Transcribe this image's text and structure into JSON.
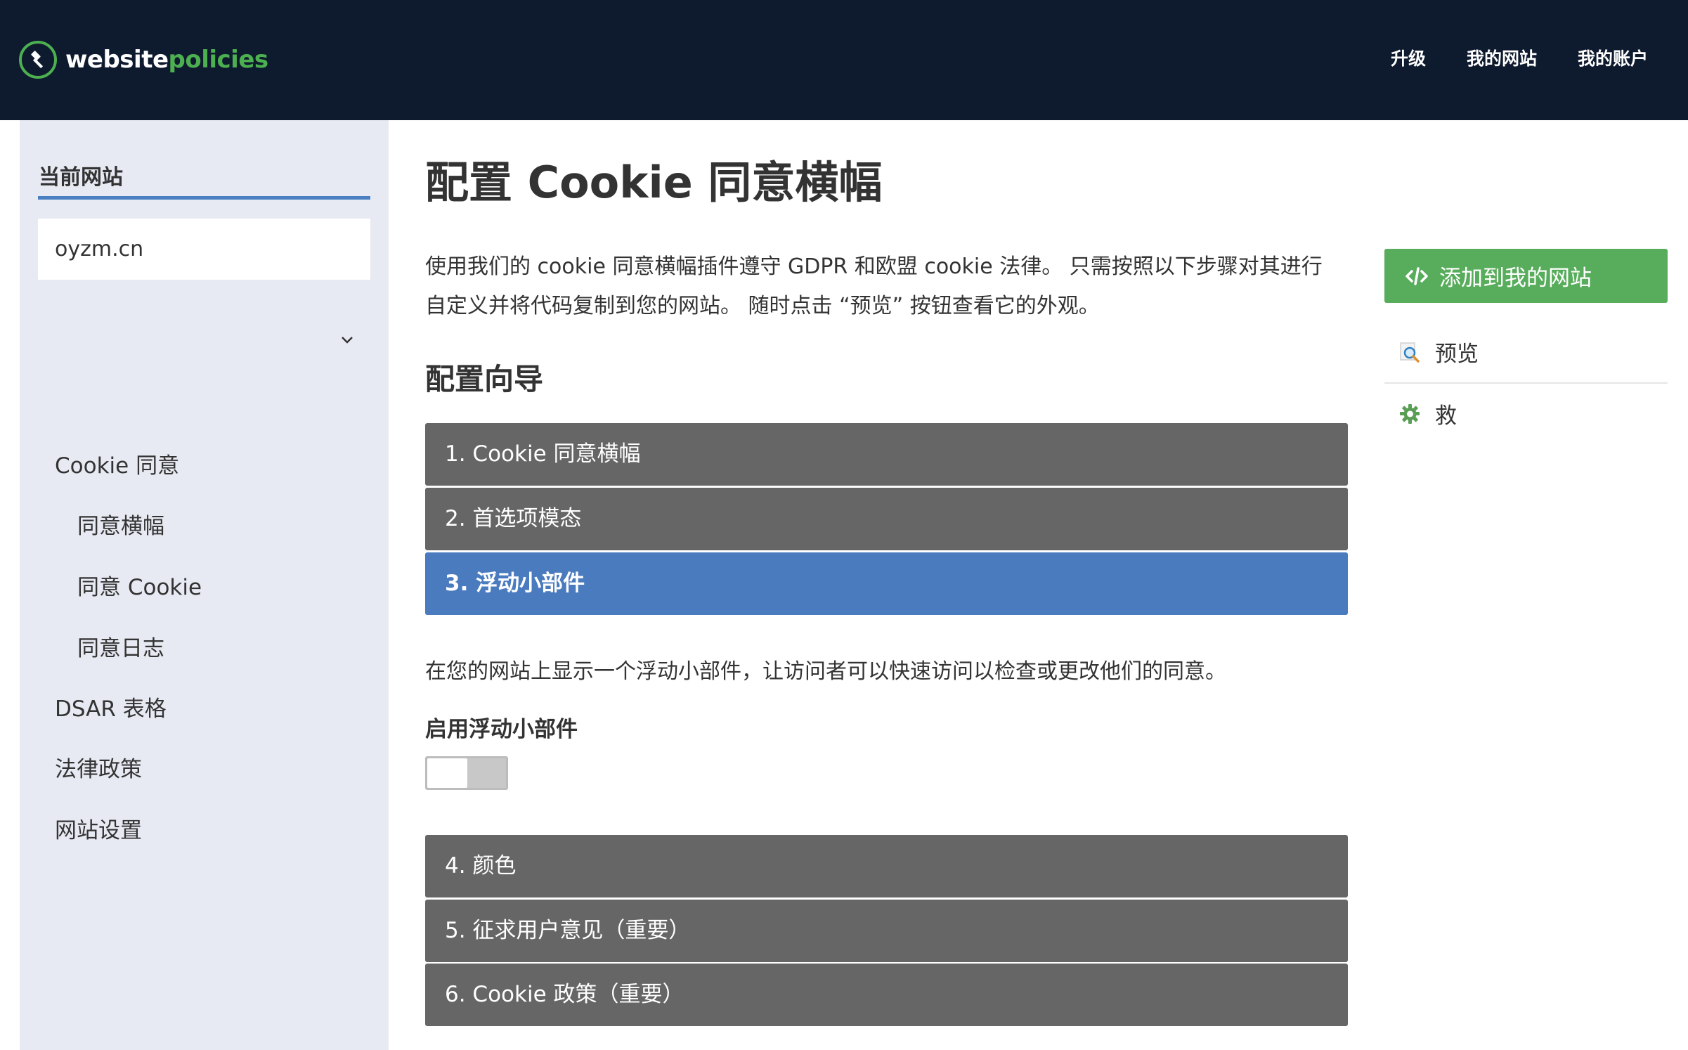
{
  "header": {
    "logo_prefix": "website",
    "logo_suffix": "policies",
    "nav": [
      "升级",
      "我的网站",
      "我的账户"
    ],
    "brand_color": "#4caf50",
    "bar_color": "#0e1a2e"
  },
  "sidebar": {
    "heading": "当前网站",
    "current_site": "oyzm.cn",
    "items": [
      {
        "label": "Cookie 同意",
        "level": "top",
        "expanded": true
      },
      {
        "label": "同意横幅",
        "level": "sub"
      },
      {
        "label": "同意 Cookie",
        "level": "sub"
      },
      {
        "label": "同意日志",
        "level": "sub"
      },
      {
        "label": "DSAR 表格",
        "level": "top"
      },
      {
        "label": "法律政策",
        "level": "top"
      },
      {
        "label": "网站设置",
        "level": "top"
      }
    ]
  },
  "main": {
    "title": "配置 Cookie 同意横幅",
    "intro_line1": "使用我们的 cookie 同意横幅插件遵守 GDPR 和欧盟 cookie 法律。 只需按照以下步骤对其进行",
    "intro_line2": "自定义并将代码复制到您的网站。 随时点击 “预览” 按钮查看它的外观。",
    "wizard_title": "配置向导",
    "steps": [
      {
        "label": "1. Cookie 同意横幅",
        "active": false
      },
      {
        "label": "2. 首选项模态",
        "active": false
      },
      {
        "label": "3. 浮动小部件",
        "active": true
      },
      {
        "label": "4. 颜色",
        "active": false
      },
      {
        "label": "5. 征求用户意见（重要）",
        "active": false
      },
      {
        "label": "6. Cookie 政策（重要）",
        "active": false
      }
    ],
    "widget_description": "在您的网站上显示一个浮动小部件，让访问者可以快速访问以检查或更改他们的同意。",
    "toggle_label": "启用浮动小部件",
    "toggle_enabled": false,
    "step_color": "#666666",
    "active_step_color": "#4a7bbf"
  },
  "actions": {
    "add_button": "添加到我的网站",
    "add_button_color": "#58ad5c",
    "preview": "预览",
    "save": "救",
    "icons": [
      "code-icon",
      "magnifier-icon",
      "gear-icon"
    ]
  }
}
